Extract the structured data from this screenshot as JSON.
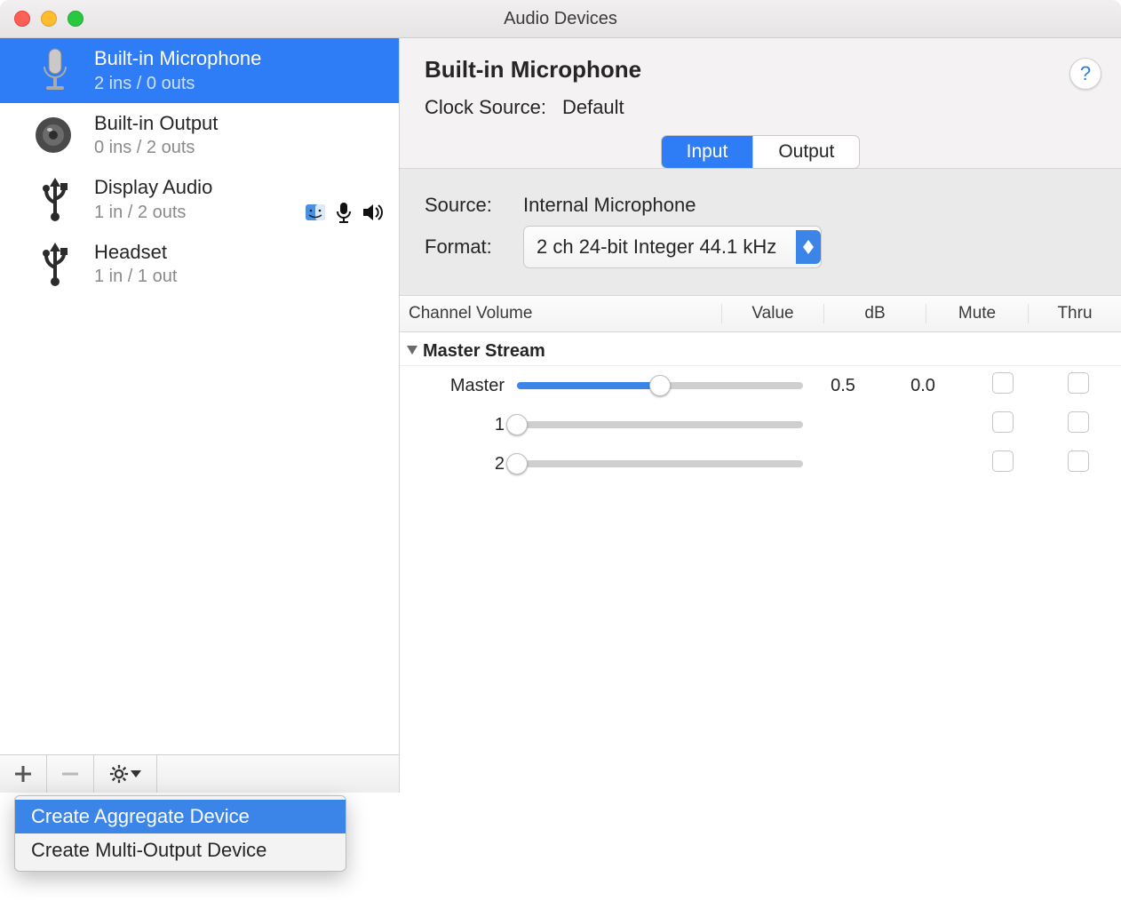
{
  "window": {
    "title": "Audio Devices"
  },
  "sidebar": {
    "devices": [
      {
        "name": "Built-in Microphone",
        "sub": "2 ins / 0 outs",
        "icon": "microphone",
        "selected": true
      },
      {
        "name": "Built-in Output",
        "sub": "0 ins / 2 outs",
        "icon": "speaker",
        "selected": false
      },
      {
        "name": "Display Audio",
        "sub": "1 in / 2 outs",
        "icon": "usb",
        "selected": false,
        "badges": [
          "finder",
          "mic",
          "speaker"
        ]
      },
      {
        "name": "Headset",
        "sub": "1 in / 1 out",
        "icon": "usb",
        "selected": false
      }
    ],
    "add_menu": {
      "items": [
        {
          "label": "Create Aggregate Device",
          "selected": true
        },
        {
          "label": "Create Multi-Output Device",
          "selected": false
        }
      ]
    }
  },
  "detail": {
    "title": "Built-in Microphone",
    "clock_label": "Clock Source:",
    "clock_value": "Default",
    "tabs": {
      "input": "Input",
      "output": "Output",
      "active": "input"
    },
    "source_label": "Source:",
    "source_value": "Internal Microphone",
    "format_label": "Format:",
    "format_value": "2 ch 24-bit Integer 44.1 kHz",
    "columns": {
      "name": "Channel Volume",
      "value": "Value",
      "db": "dB",
      "mute": "Mute",
      "thru": "Thru"
    },
    "group": "Master Stream",
    "channels": [
      {
        "name": "Master",
        "slider": 0.5,
        "value": "0.5",
        "db": "0.0",
        "mute": false,
        "thru": false,
        "enabled": true
      },
      {
        "name": "1",
        "slider": 0.0,
        "value": "",
        "db": "",
        "mute": false,
        "thru": false,
        "enabled": false
      },
      {
        "name": "2",
        "slider": 0.0,
        "value": "",
        "db": "",
        "mute": false,
        "thru": false,
        "enabled": false
      }
    ]
  }
}
